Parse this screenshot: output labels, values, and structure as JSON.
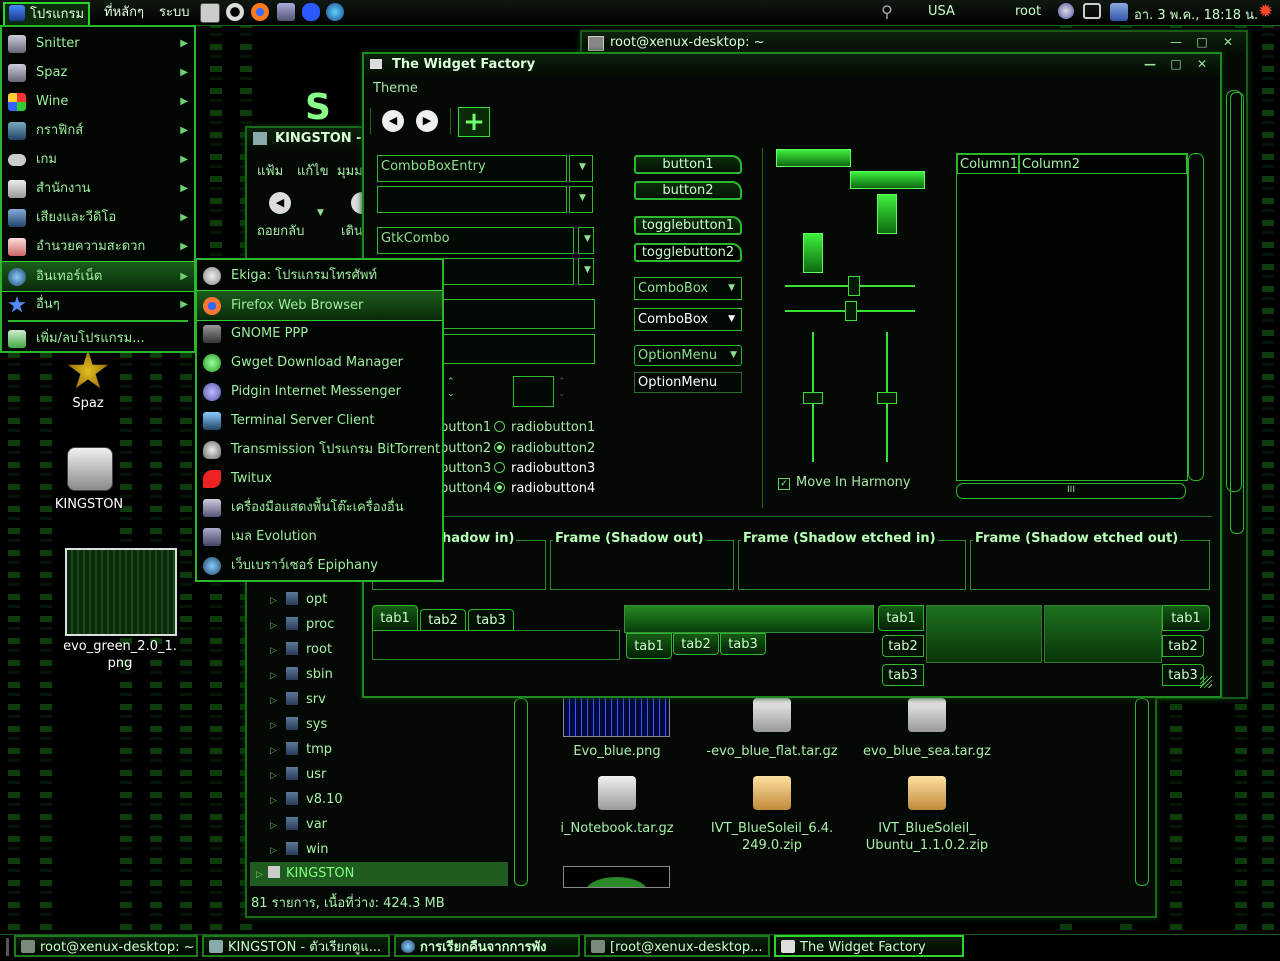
{
  "top_panel": {
    "menus": [
      "โปรแกรม",
      "ที่หลักๆ",
      "ระบบ"
    ],
    "locale": "USA",
    "user": "root",
    "clock": "อา. 3 พ.ค., 18:18 น."
  },
  "apps_menu": {
    "items": [
      {
        "label": "Snitter"
      },
      {
        "label": "Spaz"
      },
      {
        "label": "Wine"
      },
      {
        "label": "กราฟิกส์"
      },
      {
        "label": "เกม"
      },
      {
        "label": "สำนักงาน"
      },
      {
        "label": "เสียงและวีดิโอ"
      },
      {
        "label": "อำนวยความสะดวก"
      },
      {
        "label": "อินเทอร์เน็ต"
      },
      {
        "label": "อื่นๆ"
      },
      {
        "label": "เพิ่ม/ลบโปรแกรม..."
      }
    ]
  },
  "internet_menu": {
    "items": [
      {
        "label": "Ekiga: โปรแกรมโทรศัพท์"
      },
      {
        "label": "Firefox Web Browser"
      },
      {
        "label": "GNOME PPP"
      },
      {
        "label": "Gwget Download Manager"
      },
      {
        "label": "Pidgin Internet Messenger"
      },
      {
        "label": "Terminal Server Client"
      },
      {
        "label": "Transmission โปรแกรม BitTorrent"
      },
      {
        "label": "Twitux"
      },
      {
        "label": "เครื่องมือแสดงพื้นโต๊ะเครื่องอื่น"
      },
      {
        "label": "เมล Evolution"
      },
      {
        "label": "เว็บเบราว์เซอร์ Epiphany"
      }
    ]
  },
  "terminal": {
    "title": "root@xenux-desktop: ~"
  },
  "widget_factory": {
    "title": "The Widget Factory",
    "menu_theme": "Theme",
    "combo_entry": "ComboBoxEntry",
    "gtk_combo": "GtkCombo",
    "buttons": [
      "button1",
      "button2"
    ],
    "toggles": [
      "togglebutton1",
      "togglebutton2"
    ],
    "comboboxes": [
      "ComboBox",
      "ComboBox"
    ],
    "optionmenus": [
      "OptionMenu",
      "OptionMenu"
    ],
    "checkbuttons": [
      "button1",
      "button2",
      "button3",
      "button4"
    ],
    "radiobuttons": [
      "radiobutton1",
      "radiobutton2",
      "radiobutton3",
      "radiobutton4"
    ],
    "move_in_harmony": "Move In Harmony",
    "columns": [
      "Column1",
      "Column2"
    ],
    "frames": [
      "hadow in)",
      "Frame (Shadow out)",
      "Frame (Shadow etched in)",
      "Frame (Shadow etched out)"
    ],
    "tabs": [
      "tab1",
      "tab2",
      "tab3"
    ],
    "scroll_grip": "III"
  },
  "file_manager": {
    "title": "KINGSTON -",
    "menu": [
      "แฟ้ม",
      "แก้ไข",
      "มุมม"
    ],
    "back_label": "ถอยกลับ",
    "forward_label": "เดิน",
    "tree": [
      "opt",
      "proc",
      "root",
      "sbin",
      "srv",
      "sys",
      "tmp",
      "usr",
      "v8.10",
      "var",
      "win"
    ],
    "tree_selected": "KINGSTON",
    "files": [
      {
        "name": "Evo_blue.png"
      },
      {
        "name": "-evo_blue_flat.tar.gz"
      },
      {
        "name": "evo_blue_sea.tar.gz"
      },
      {
        "name": "i_Notebook.tar.gz"
      },
      {
        "name": "IVT_BlueSoleil_6.4.\n249.0.zip"
      },
      {
        "name": "IVT_BlueSoleil_\nUbuntu_1.1.0.2.zip"
      }
    ],
    "status": "81 รายการ, เนื้อที่ว่าง: 424.3 MB"
  },
  "desktop": {
    "icons": [
      {
        "label": "Spaz"
      },
      {
        "label": "KINGSTON"
      },
      {
        "label": "evo_green_2.0_1.\npng"
      }
    ]
  },
  "taskbar": {
    "items": [
      {
        "label": "root@xenux-desktop: ~"
      },
      {
        "label": "KINGSTON - ตัวเรียกดูแ..."
      },
      {
        "label": "การเรียกคืนจากการพัง"
      },
      {
        "label": "[root@xenux-desktop..."
      },
      {
        "label": "The Widget Factory"
      }
    ]
  },
  "colors": {
    "accent": "#2ed42e",
    "text": "#8fe08f",
    "bg": "#000000"
  }
}
